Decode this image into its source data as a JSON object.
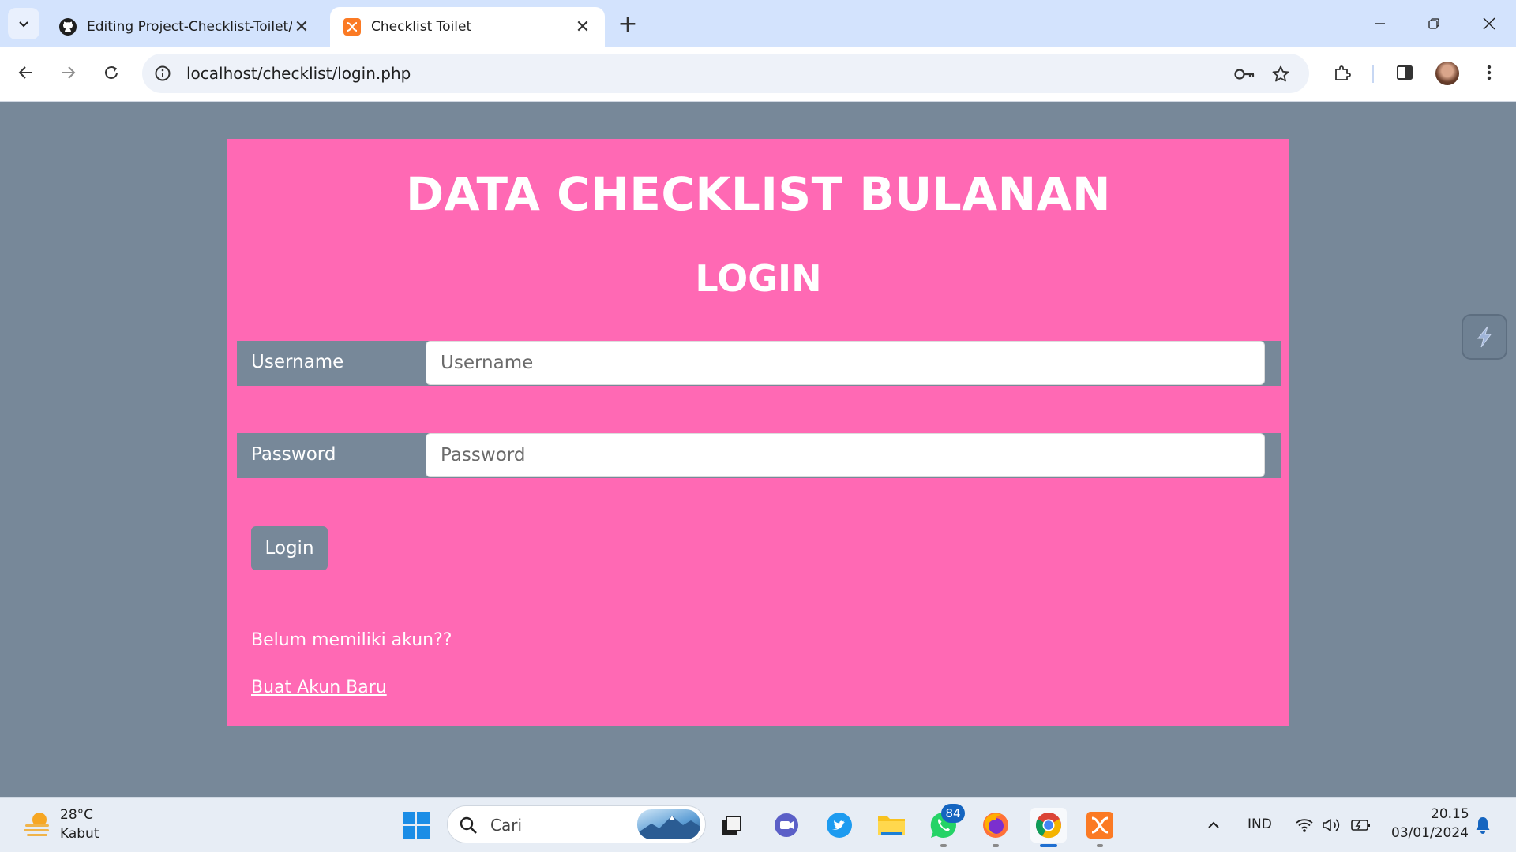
{
  "browser": {
    "tabs": [
      {
        "title": "Editing Project-Checklist-Toilet/",
        "icon": "github-icon",
        "active": false
      },
      {
        "title": "Checklist Toilet",
        "icon": "xampp-icon",
        "active": true
      }
    ],
    "new_tab_label": "+",
    "address": "localhost/checklist/login.php"
  },
  "page": {
    "site_title": "DATA CHECKLIST BULANAN",
    "heading": "LOGIN",
    "username": {
      "label": "Username",
      "placeholder": "Username",
      "value": ""
    },
    "password": {
      "label": "Password",
      "placeholder": "Password",
      "value": ""
    },
    "login_button": "Login",
    "register_prompt": "Belum memiliki akun??",
    "register_link": "Buat Akun Baru",
    "colors": {
      "card": "#ff69b4",
      "background": "#778899",
      "label_bar": "#778899"
    }
  },
  "taskbar": {
    "weather": {
      "temp": "28°C",
      "condition": "Kabut"
    },
    "search_placeholder": "Cari",
    "pinned": [
      "windows-start-icon",
      "task-view-icon",
      "meet-icon",
      "twitter-icon",
      "file-explorer-icon",
      "whatsapp-icon",
      "firefox-icon",
      "chrome-icon",
      "xampp-icon"
    ],
    "whatsapp_badge": "84",
    "tray": {
      "language": "IND",
      "time": "20.15",
      "date": "03/01/2024"
    }
  }
}
